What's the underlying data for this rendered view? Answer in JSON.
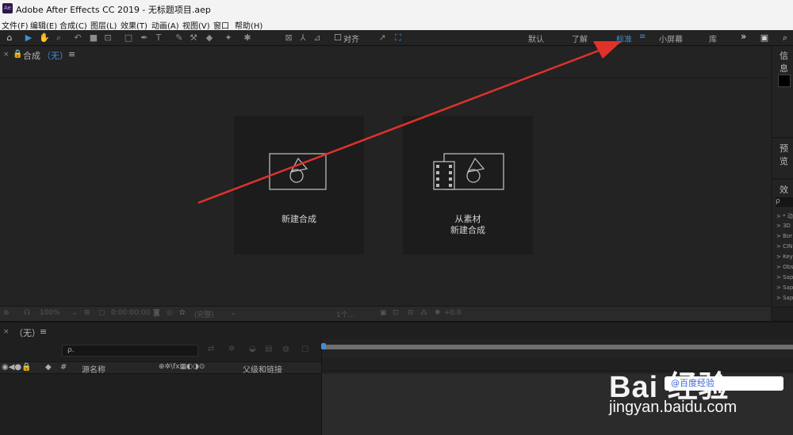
{
  "window": {
    "title": "Adobe After Effects CC 2019 - 无标题项目.aep",
    "logo_text": "Ae"
  },
  "menu": [
    "文件(F)",
    "编辑(E)",
    "合成(C)",
    "图层(L)",
    "效果(T)",
    "动画(A)",
    "视图(V)",
    "窗口",
    "帮助(H)"
  ],
  "toolbar": {
    "align_label": "对齐"
  },
  "workspaces": {
    "default": "默认",
    "learn": "了解",
    "standard": "标准",
    "small_screen": "小屏幕",
    "library": "库",
    "more": "»"
  },
  "comp_panel": {
    "tab_prefix": "合成",
    "tab_value": "（无）"
  },
  "cards": {
    "new_comp": "新建合成",
    "from_footage_line1": "从素材",
    "from_footage_line2": "新建合成"
  },
  "viewer_bar": {
    "zoom": "100%",
    "timecode": "0:00:00:00",
    "resolution": "(完整)",
    "views": "1个...",
    "exposure": "+0.0"
  },
  "right_panels": {
    "info": "信息",
    "preview": "预览",
    "effects": "效果",
    "effects_search": "ρ",
    "effects_items": [
      "> * 动",
      "> 3D",
      "> Bor",
      "> CIN",
      "> Key",
      "> Obs",
      "> Sap",
      "> Sap",
      "> Sap"
    ]
  },
  "timeline": {
    "tab_value": "（无）",
    "search_placeholder": "ρ.",
    "header": {
      "source_name": "源名称",
      "parent_link": "父级和链接",
      "hash": "#"
    }
  },
  "watermark": {
    "logo": "Bai 经验",
    "url": "jingyan.baidu.com",
    "pill": "@百度经验"
  },
  "colors": {
    "accent_blue": "#3f8fd6",
    "arrow_red": "#e0322b",
    "panel_bg": "#232323"
  }
}
